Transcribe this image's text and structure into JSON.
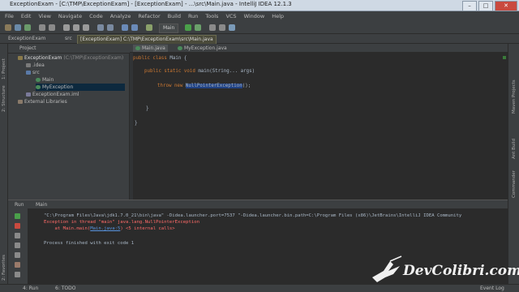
{
  "window": {
    "title": "ExceptionExam - [C:\\TMP\\ExceptionExam] - [ExceptionExam] - ...\\src\\Main.java - IntelliJ IDEA 12.1.3",
    "min": "–",
    "max": "□",
    "close": "✕"
  },
  "menu": [
    "File",
    "Edit",
    "View",
    "Navigate",
    "Code",
    "Analyze",
    "Refactor",
    "Build",
    "Run",
    "Tools",
    "VCS",
    "Window",
    "Help"
  ],
  "toolbar": {
    "run_config": "Main"
  },
  "navbar": {
    "crumbs": [
      "ExceptionExam",
      "src"
    ],
    "tooltip": "[ExceptionExam] C:\\TMP\\ExceptionExam\\src\\Main.java"
  },
  "left_strip": [
    "1: Project",
    "2: Structure",
    "2: Favorites"
  ],
  "right_strip": [
    "Maven Projects",
    "Ant Build",
    "Commander"
  ],
  "project": {
    "header": "Project",
    "tree": [
      {
        "label": "ExceptionExam",
        "extra": "(C:\\TMP\\ExceptionExam)"
      },
      {
        "label": ".idea"
      },
      {
        "label": "src"
      },
      {
        "label": "Main"
      },
      {
        "label": "MyException"
      },
      {
        "label": "ExceptionExam.iml"
      },
      {
        "label": "External Libraries"
      }
    ]
  },
  "tabs": [
    "Main.java",
    "MyException.java"
  ],
  "editor": {
    "line1_kw": "public class",
    "line1_rest": " Main {",
    "line2_kw": "public static void",
    "line2_rest": " main(String... args)",
    "line3_kw": "throw new",
    "line3_hl": "NullPointerException",
    "line3_rest": "();",
    "line4": "}",
    "line5": "}"
  },
  "run_panel": {
    "header_label": "Run",
    "config": "Main",
    "cmd": "\"C:\\Program Files\\Java\\jdk1.7.0_21\\bin\\java\" -Didea.launcher.port=7537 \"-Didea.launcher.bin.path=C:\\Program Files (x86)\\JetBrains\\IntelliJ IDEA Community",
    "err1": "Exception in thread \"main\" java.lang.NullPointerException",
    "err2_prefix": "    at Main.main(",
    "err2_link": "Main.java:5",
    "err2_suffix": ") <5 internal calls>",
    "finish": "Process finished with exit code 1"
  },
  "status": {
    "left1": "4: Run",
    "left2": "6: TODO",
    "right": "Event Log"
  },
  "watermark": "DevColibri.com",
  "colors": {
    "accent_blue": "#214283",
    "error_red": "#ff6b68",
    "keyword_orange": "#cc7832"
  }
}
